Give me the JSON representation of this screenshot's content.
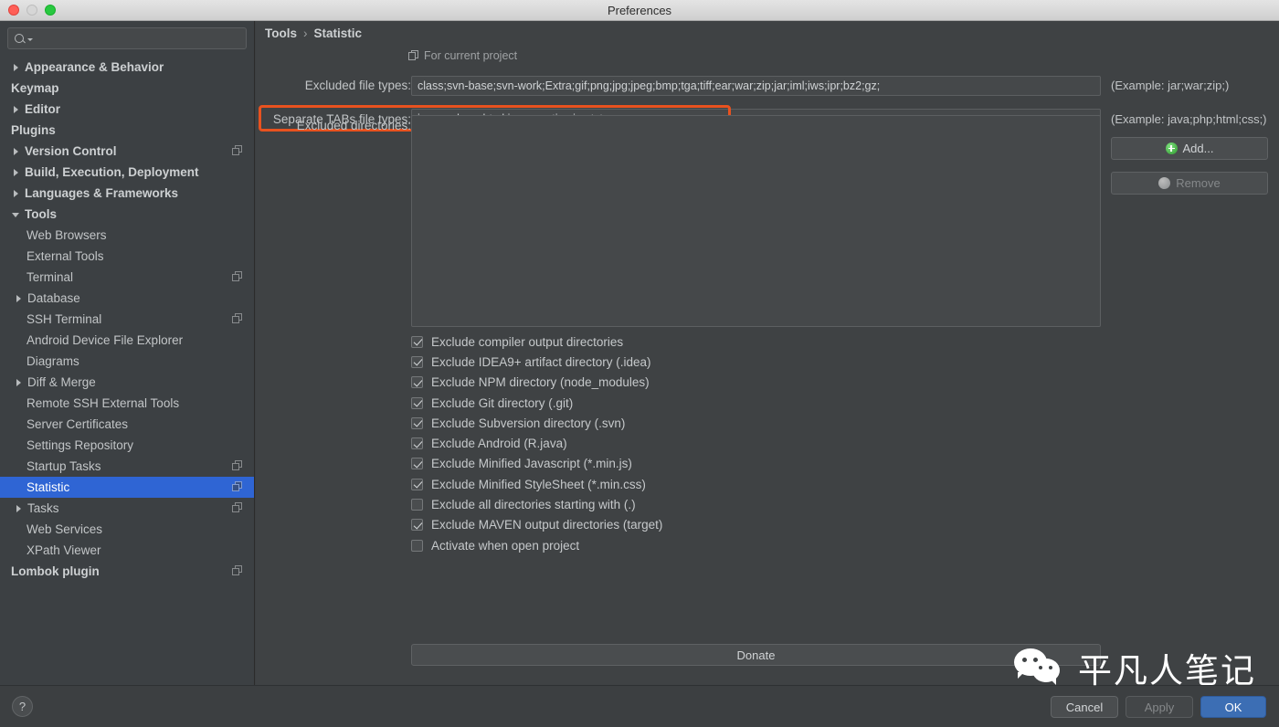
{
  "window": {
    "title": "Preferences",
    "traffic_lights": [
      "close",
      "minimize",
      "zoom"
    ]
  },
  "sidebar": {
    "search_placeholder": "",
    "search_value": "",
    "items": [
      {
        "label": "Appearance & Behavior",
        "level": 0,
        "arrow": "closed",
        "bold": true,
        "selected": false,
        "copy": false
      },
      {
        "label": "Keymap",
        "level": 0,
        "arrow": "none",
        "bold": true,
        "selected": false,
        "copy": false
      },
      {
        "label": "Editor",
        "level": 0,
        "arrow": "closed",
        "bold": true,
        "selected": false,
        "copy": false
      },
      {
        "label": "Plugins",
        "level": 0,
        "arrow": "none",
        "bold": true,
        "selected": false,
        "copy": false
      },
      {
        "label": "Version Control",
        "level": 0,
        "arrow": "closed",
        "bold": true,
        "selected": false,
        "copy": true
      },
      {
        "label": "Build, Execution, Deployment",
        "level": 0,
        "arrow": "closed",
        "bold": true,
        "selected": false,
        "copy": false
      },
      {
        "label": "Languages & Frameworks",
        "level": 0,
        "arrow": "closed",
        "bold": true,
        "selected": false,
        "copy": false
      },
      {
        "label": "Tools",
        "level": 0,
        "arrow": "open",
        "bold": true,
        "selected": false,
        "copy": false
      },
      {
        "label": "Web Browsers",
        "level": 1,
        "arrow": "none",
        "bold": false,
        "selected": false,
        "copy": false
      },
      {
        "label": "External Tools",
        "level": 1,
        "arrow": "none",
        "bold": false,
        "selected": false,
        "copy": false
      },
      {
        "label": "Terminal",
        "level": 1,
        "arrow": "none",
        "bold": false,
        "selected": false,
        "copy": true
      },
      {
        "label": "Database",
        "level": 1,
        "arrow": "closed",
        "bold": false,
        "selected": false,
        "copy": false
      },
      {
        "label": "SSH Terminal",
        "level": 1,
        "arrow": "none",
        "bold": false,
        "selected": false,
        "copy": true
      },
      {
        "label": "Android Device File Explorer",
        "level": 1,
        "arrow": "none",
        "bold": false,
        "selected": false,
        "copy": false
      },
      {
        "label": "Diagrams",
        "level": 1,
        "arrow": "none",
        "bold": false,
        "selected": false,
        "copy": false
      },
      {
        "label": "Diff & Merge",
        "level": 1,
        "arrow": "closed",
        "bold": false,
        "selected": false,
        "copy": false
      },
      {
        "label": "Remote SSH External Tools",
        "level": 1,
        "arrow": "none",
        "bold": false,
        "selected": false,
        "copy": false
      },
      {
        "label": "Server Certificates",
        "level": 1,
        "arrow": "none",
        "bold": false,
        "selected": false,
        "copy": false
      },
      {
        "label": "Settings Repository",
        "level": 1,
        "arrow": "none",
        "bold": false,
        "selected": false,
        "copy": false
      },
      {
        "label": "Startup Tasks",
        "level": 1,
        "arrow": "none",
        "bold": false,
        "selected": false,
        "copy": true
      },
      {
        "label": "Statistic",
        "level": 1,
        "arrow": "none",
        "bold": false,
        "selected": true,
        "copy": true
      },
      {
        "label": "Tasks",
        "level": 1,
        "arrow": "closed",
        "bold": false,
        "selected": false,
        "copy": true
      },
      {
        "label": "Web Services",
        "level": 1,
        "arrow": "none",
        "bold": false,
        "selected": false,
        "copy": false
      },
      {
        "label": "XPath Viewer",
        "level": 1,
        "arrow": "none",
        "bold": false,
        "selected": false,
        "copy": false
      },
      {
        "label": "Lombok plugin",
        "level": 0,
        "arrow": "none",
        "bold": true,
        "selected": false,
        "copy": true
      }
    ]
  },
  "main": {
    "breadcrumb": {
      "parent": "Tools",
      "separator": "›",
      "current": "Statistic"
    },
    "scope_label": "For current project",
    "fields": {
      "excluded_file_types": {
        "label": "Excluded file types:",
        "value": "class;svn-base;svn-work;Extra;gif;png;jpg;jpeg;bmp;tga;tiff;ear;war;zip;jar;iml;iws;ipr;bz2;gz;",
        "hint": "(Example: jar;war;zip;)"
      },
      "separate_tabs_file_types": {
        "label": "Separate TABs file types:",
        "value": "java;xml;css;html;js;properties;jsp;txt;",
        "hint": "(Example: java;php;html;css;)",
        "highlighted": true
      },
      "excluded_directories": {
        "label": "Excluded directories:",
        "value": ""
      }
    },
    "side_buttons": {
      "add": "Add...",
      "remove": "Remove"
    },
    "checkboxes": [
      {
        "label": "Exclude compiler output directories",
        "checked": true
      },
      {
        "label": "Exclude IDEA9+ artifact directory (.idea)",
        "checked": true
      },
      {
        "label": "Exclude NPM directory (node_modules)",
        "checked": true
      },
      {
        "label": "Exclude Git directory (.git)",
        "checked": true
      },
      {
        "label": "Exclude Subversion directory (.svn)",
        "checked": true
      },
      {
        "label": "Exclude Android (R.java)",
        "checked": true
      },
      {
        "label": "Exclude Minified Javascript (*.min.js)",
        "checked": true
      },
      {
        "label": "Exclude Minified StyleSheet (*.min.css)",
        "checked": true
      },
      {
        "label": "Exclude all directories starting with (.)",
        "checked": false
      },
      {
        "label": "Exclude MAVEN output directories (target)",
        "checked": true
      },
      {
        "label": "Activate when open project",
        "checked": false
      }
    ],
    "donate_label": "Donate"
  },
  "footer": {
    "help_label": "?",
    "cancel_label": "Cancel",
    "apply_label": "Apply",
    "ok_label": "OK"
  },
  "watermark": {
    "text": "平凡人笔记"
  },
  "colors": {
    "accent_selection": "#2f65d4",
    "highlight_outline": "#e8521f",
    "ok_button": "#3c6eb4",
    "background": "#3f4244",
    "sidebar_background": "#3c4043"
  }
}
